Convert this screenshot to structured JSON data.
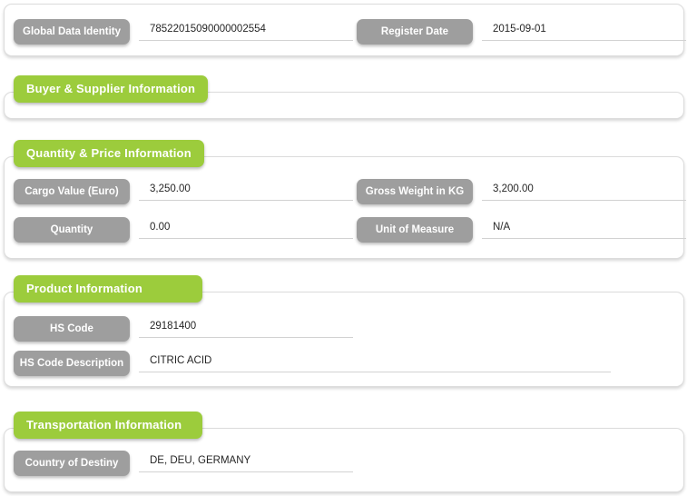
{
  "theme": {
    "accent_green": "#9CCC3C",
    "pill_gray": "#9E9E9E",
    "panel_border": "#DCDCDC",
    "underline": "#D2D2D2",
    "value_text": "#262626",
    "page_background": "#FFFFFF"
  },
  "sections": [
    {
      "id": "identity",
      "title": null,
      "fields": [
        {
          "label": "Global Data Identity",
          "value": "78522015090000002554",
          "column": "left",
          "width": "short"
        },
        {
          "label": "Register Date",
          "value": "2015-09-01",
          "column": "right",
          "width": "right"
        }
      ]
    },
    {
      "id": "buyer-supplier",
      "title": "Buyer & Supplier Information",
      "fields": []
    },
    {
      "id": "quantity-price",
      "title": "Quantity & Price Information",
      "fields": [
        {
          "label": "Cargo Value (Euro)",
          "value": "3,250.00",
          "column": "left",
          "width": "short"
        },
        {
          "label": "Gross Weight in KG",
          "value": "3,200.00",
          "column": "right",
          "width": "right"
        },
        {
          "label": "Quantity",
          "value": "0.00",
          "column": "left",
          "width": "short"
        },
        {
          "label": "Unit of Measure",
          "value": "N/A",
          "column": "right",
          "width": "right"
        }
      ]
    },
    {
      "id": "product",
      "title": "Product Information",
      "fields": [
        {
          "label": "HS Code",
          "value": "29181400",
          "column": "left",
          "width": "short"
        },
        {
          "label": "HS Code Description",
          "value": "CITRIC ACID",
          "column": "left",
          "width": "long"
        }
      ]
    },
    {
      "id": "transportation",
      "title": "Transportation Information",
      "fields": [
        {
          "label": "Country of Destiny",
          "value": "DE, DEU, GERMANY",
          "column": "left",
          "width": "short"
        }
      ]
    }
  ]
}
